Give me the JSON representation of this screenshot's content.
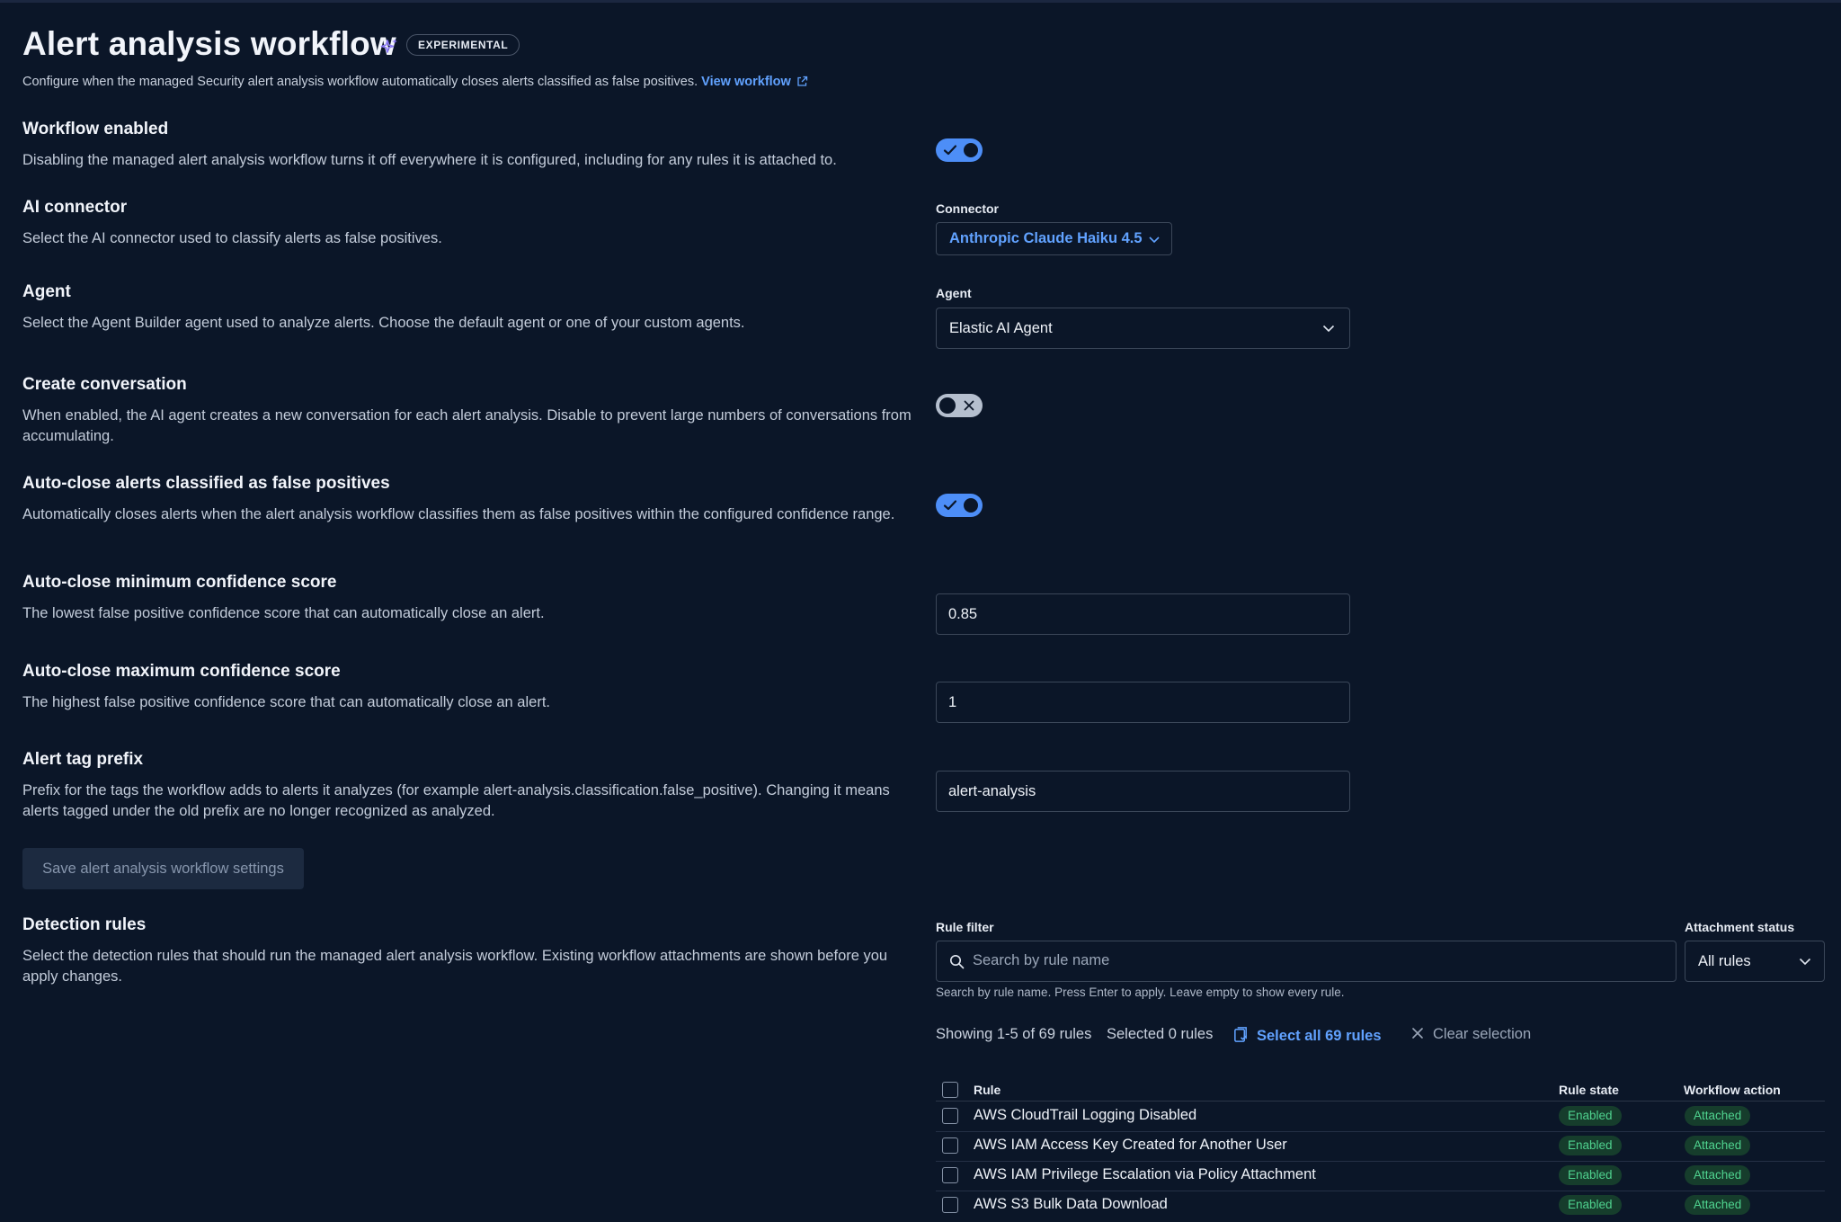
{
  "header": {
    "title": "Alert analysis workflow",
    "badge": "EXPERIMENTAL",
    "description": "Configure when the managed Security alert analysis workflow automatically closes alerts classified as false positives.",
    "view_workflow_link": "View workflow"
  },
  "sections": {
    "workflow_enabled": {
      "title": "Workflow enabled",
      "description": "Disabling the managed alert analysis workflow turns it off everywhere it is configured, including for any rules it is attached to.",
      "toggle_on": true
    },
    "ai_connector": {
      "title": "AI connector",
      "description": "Select the AI connector used to classify alerts as false positives.",
      "field_label": "Connector",
      "selected_value": "Anthropic Claude Haiku 4.5"
    },
    "agent": {
      "title": "Agent",
      "description": "Select the Agent Builder agent used to analyze alerts. Choose the default agent or one of your custom agents.",
      "field_label": "Agent",
      "selected_value": "Elastic AI Agent"
    },
    "create_conversation": {
      "title": "Create conversation",
      "description": "When enabled, the AI agent creates a new conversation for each alert analysis. Disable to prevent large numbers of conversations from accumulating.",
      "toggle_on": false
    },
    "auto_close": {
      "title": "Auto-close alerts classified as false positives",
      "description": "Automatically closes alerts when the alert analysis workflow classifies them as false positives within the configured confidence range.",
      "toggle_on": true
    },
    "min_confidence": {
      "title": "Auto-close minimum confidence score",
      "description": "The lowest false positive confidence score that can automatically close an alert.",
      "value": "0.85"
    },
    "max_confidence": {
      "title": "Auto-close maximum confidence score",
      "description": "The highest false positive confidence score that can automatically close an alert.",
      "value": "1"
    },
    "tag_prefix": {
      "title": "Alert tag prefix",
      "description": "Prefix for the tags the workflow adds to alerts it analyzes (for example alert-analysis.classification.false_positive). Changing it means alerts tagged under the old prefix are no longer recognized as analyzed.",
      "value": "alert-analysis"
    }
  },
  "save_button": "Save alert analysis workflow settings",
  "detection_rules": {
    "title": "Detection rules",
    "description": "Select the detection rules that should run the managed alert analysis workflow. Existing workflow attachments are shown before you apply changes.",
    "rule_filter_label": "Rule filter",
    "search_placeholder": "Search by rule name",
    "search_help": "Search by rule name. Press Enter to apply. Leave empty to show every rule.",
    "attachment_status_label": "Attachment status",
    "attachment_status_value": "All rules",
    "showing_text": "Showing 1-5 of 69 rules",
    "selected_text": "Selected 0 rules",
    "select_all_link": "Select all 69 rules",
    "clear_selection": "Clear selection",
    "columns": {
      "rule": "Rule",
      "rule_state": "Rule state",
      "workflow_action": "Workflow action"
    },
    "rows": [
      {
        "rule": "AWS CloudTrail Logging Disabled",
        "state": "Enabled",
        "action": "Attached"
      },
      {
        "rule": "AWS IAM Access Key Created for Another User",
        "state": "Enabled",
        "action": "Attached"
      },
      {
        "rule": "AWS IAM Privilege Escalation via Policy Attachment",
        "state": "Enabled",
        "action": "Attached"
      },
      {
        "rule": "AWS S3 Bulk Data Download",
        "state": "Enabled",
        "action": "Attached"
      }
    ]
  },
  "colors": {
    "background": "#0b1628",
    "accent": "#61a2ff",
    "toggle_on": "#4d8ef7",
    "success_text": "#4fd38f",
    "success_bg": "#163d2c"
  }
}
